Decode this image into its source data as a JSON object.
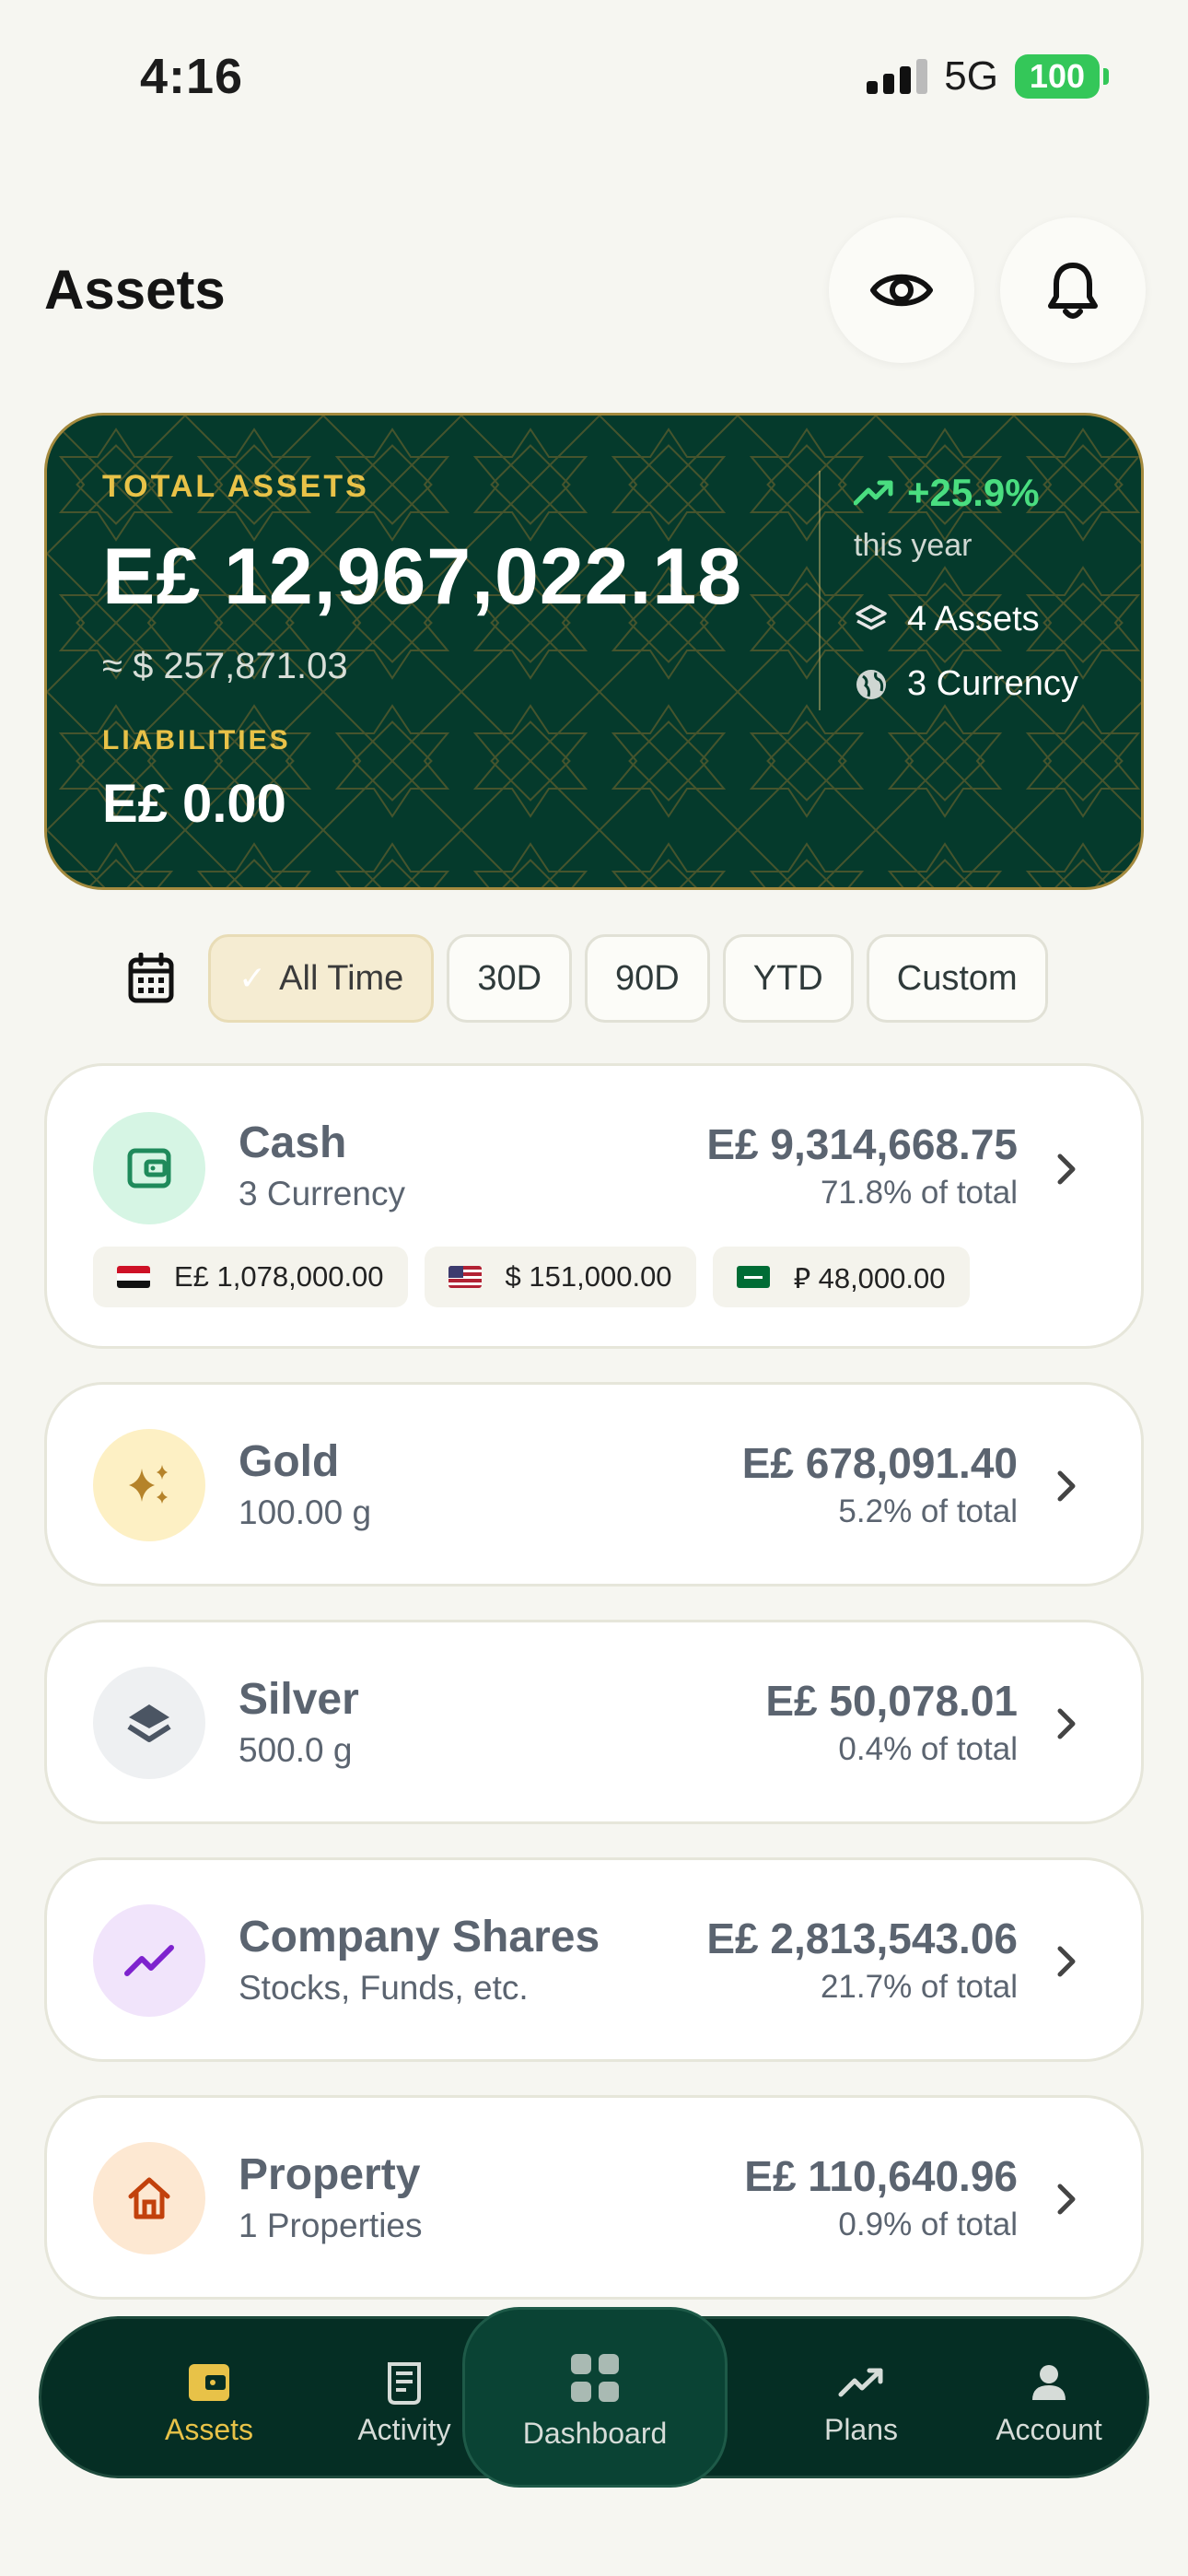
{
  "status_bar": {
    "time": "4:16",
    "network": "5G",
    "battery": "100"
  },
  "header": {
    "title": "Assets"
  },
  "summary": {
    "total_label": "TOTAL ASSETS",
    "total_value": "E£ 12,967,022.18",
    "total_usd": "≈ $ 257,871.03",
    "liabilities_label": "LIABILITIES",
    "liabilities_value": "E£ 0.00",
    "change": "+25.9%",
    "change_period": "this year",
    "assets_count": "4 Assets",
    "currency_count": "3 Currency"
  },
  "filters": {
    "options": [
      "All Time",
      "30D",
      "90D",
      "YTD",
      "Custom"
    ],
    "selected": "All Time"
  },
  "assets": [
    {
      "name": "Cash",
      "subtitle": "3 Currency",
      "value": "E£ 9,314,668.75",
      "share": "71.8% of total",
      "currencies": [
        "E£ 1,078,000.00",
        "$ 151,000.00",
        "⃁ 48,000.00"
      ]
    },
    {
      "name": "Gold",
      "subtitle": "100.00 g",
      "value": "E£ 678,091.40",
      "share": "5.2% of total"
    },
    {
      "name": "Silver",
      "subtitle": "500.0 g",
      "value": "E£ 50,078.01",
      "share": "0.4% of total"
    },
    {
      "name": "Company Shares",
      "subtitle": "Stocks, Funds, etc.",
      "value": "E£ 2,813,543.06",
      "share": "21.7% of total"
    },
    {
      "name": "Property",
      "subtitle": "1 Properties",
      "value": "E£ 110,640.96",
      "share": "0.9% of total"
    }
  ],
  "nav": {
    "items": [
      "Assets",
      "Activity",
      "Dashboard",
      "Plans",
      "Account"
    ],
    "active": "Assets"
  },
  "colors": {
    "accent_gold": "#e8c248",
    "hero_bg": "#053a2c",
    "positive": "#4ade80",
    "nav_bg": "#052e24"
  }
}
